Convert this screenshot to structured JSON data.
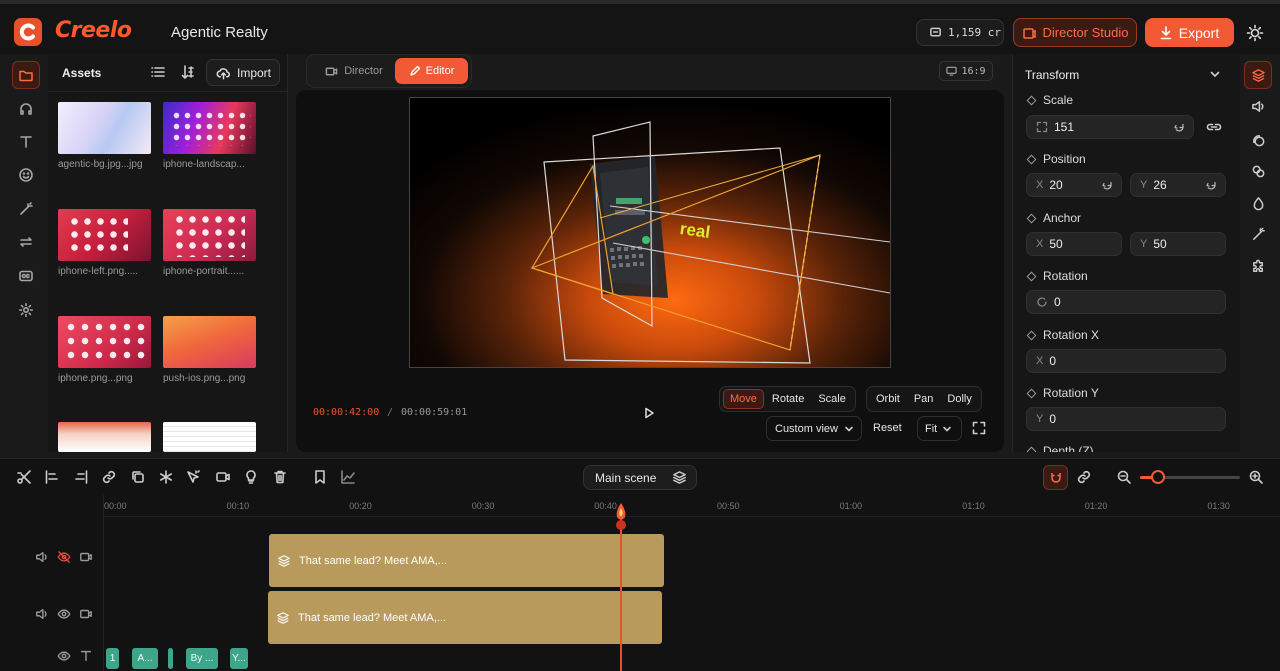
{
  "header": {
    "project_name": "Agentic Realty",
    "credits": "1,159 cr",
    "director_studio_label": "Director Studio",
    "export_label": "Export"
  },
  "assets": {
    "title": "Assets",
    "import_label": "Import",
    "items": [
      {
        "name": "agentic-bg.jpg...jpg"
      },
      {
        "name": "iphone-landscap..."
      },
      {
        "name": "iphone-left.png....."
      },
      {
        "name": "iphone-portrait......"
      },
      {
        "name": "iphone.png...png"
      },
      {
        "name": "push-ios.png...png"
      }
    ]
  },
  "center": {
    "tabs": {
      "director": "Director",
      "editor": "Editor"
    },
    "aspect": "16:9",
    "canvas_text": "real",
    "time_current": "00:00:42:00",
    "time_separator": "/",
    "time_total": "00:00:59:01",
    "transform_modes": [
      "Move",
      "Rotate",
      "Scale"
    ],
    "camera_modes": [
      "Orbit",
      "Pan",
      "Dolly"
    ],
    "view_select": "Custom view",
    "reset_label": "Reset",
    "fit_select": "Fit"
  },
  "inspector": {
    "title": "Transform",
    "scale": {
      "label": "Scale",
      "value": "151"
    },
    "position": {
      "label": "Position",
      "x_prefix": "X",
      "x": "20",
      "y_prefix": "Y",
      "y": "26"
    },
    "anchor": {
      "label": "Anchor",
      "x_prefix": "X",
      "x": "50",
      "y_prefix": "Y",
      "y": "50"
    },
    "rotation": {
      "label": "Rotation",
      "value": "0"
    },
    "rotation_x": {
      "label": "Rotation X",
      "prefix": "X",
      "value": "0"
    },
    "rotation_y": {
      "label": "Rotation Y",
      "prefix": "Y",
      "value": "0"
    },
    "depth": {
      "label": "Depth (Z)"
    }
  },
  "timeline": {
    "scene": "Main scene",
    "ticks": [
      "00:00",
      "00:10",
      "00:20",
      "00:30",
      "00:40",
      "00:50",
      "01:00",
      "01:10",
      "01:20",
      "01:30"
    ],
    "clips": [
      {
        "label": "That same lead? Meet AMA,..."
      },
      {
        "label": "That same lead? Meet AMA,..."
      }
    ],
    "mini_clips": [
      "1",
      "A...",
      "",
      "By ...",
      "Y..."
    ],
    "zoom_level": 0.18
  },
  "colors": {
    "accent": "#f15a34",
    "clip": "#b89a5d",
    "text_clip": "#3fa58a"
  }
}
